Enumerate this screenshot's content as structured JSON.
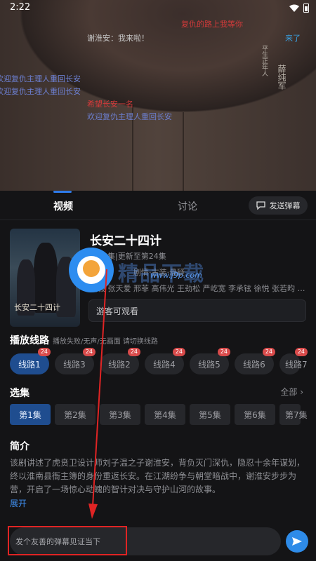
{
  "status_bar": {
    "time": "2:22"
  },
  "video": {
    "danmaku": [
      {
        "text": "复仇的路上我等你",
        "color": "#d23a3a"
      },
      {
        "text": "谢淮安：我来啦！",
        "color": "#c8c8c8"
      },
      {
        "text": "来了",
        "color": "#3aa0e0"
      },
      {
        "text": "欢迎复仇主理人重回长安",
        "color": "#6c7fd0"
      },
      {
        "text": "欢迎复仇主理人重回长安",
        "color": "#6c7fd0"
      },
      {
        "text": "希望长安一名",
        "color": "#d23a3a"
      },
      {
        "text": "欢迎复仇主理人重回长安",
        "color": "#6c7fd0"
      }
    ],
    "vertical_text": {
      "left": "平生正年人",
      "right": "薛纯军"
    }
  },
  "tabs": {
    "video": "视频",
    "discussion": "讨论"
  },
  "danmu_button": "发送弹幕",
  "show": {
    "title": "长安二十四计",
    "poster_title": "长安二十四计",
    "update": "全36集|更新至第24集",
    "year": "2025",
    "tags": "剧情·古装·悬疑",
    "cast": "成毅 张天爱 邢菲 高伟光 王劲松 严屹宽 李承铉 徐悦 张若昀 李梦 倪大红 张涵予",
    "notice": "游客可观看"
  },
  "watermark": {
    "text": "精品下载",
    "url": "www.j9p.com"
  },
  "lines": {
    "heading": "播放线路",
    "hint": "播放失败/无声/无画面 请切换线路",
    "items": [
      {
        "label": "线路1",
        "badge": "24"
      },
      {
        "label": "线路3",
        "badge": "24"
      },
      {
        "label": "线路2",
        "badge": "24"
      },
      {
        "label": "线路4",
        "badge": "24"
      },
      {
        "label": "线路5",
        "badge": "24"
      },
      {
        "label": "线路6",
        "badge": "24"
      },
      {
        "label": "线路7",
        "badge": "24"
      }
    ]
  },
  "episodes": {
    "heading": "选集",
    "all_label": "全部",
    "items": [
      "第1集",
      "第2集",
      "第3集",
      "第4集",
      "第5集",
      "第6集",
      "第7集"
    ]
  },
  "intro": {
    "heading": "简介",
    "text": "该剧讲述了虎贲卫设计师刘子温之子谢淮安，背负灭门深仇，隐忍十余年谋划，终以淮南县衙主簿的身份重返长安。在江湖纷争与朝堂暗战中，谢淮安步步为营，开启了一场惊心动魄的智计对决与守护山河的故事。",
    "expand": "展开"
  },
  "comment_input": {
    "placeholder": "发个友善的弹幕见证当下"
  },
  "colors": {
    "accent": "#2e8be8",
    "annotation": "#e02424"
  }
}
